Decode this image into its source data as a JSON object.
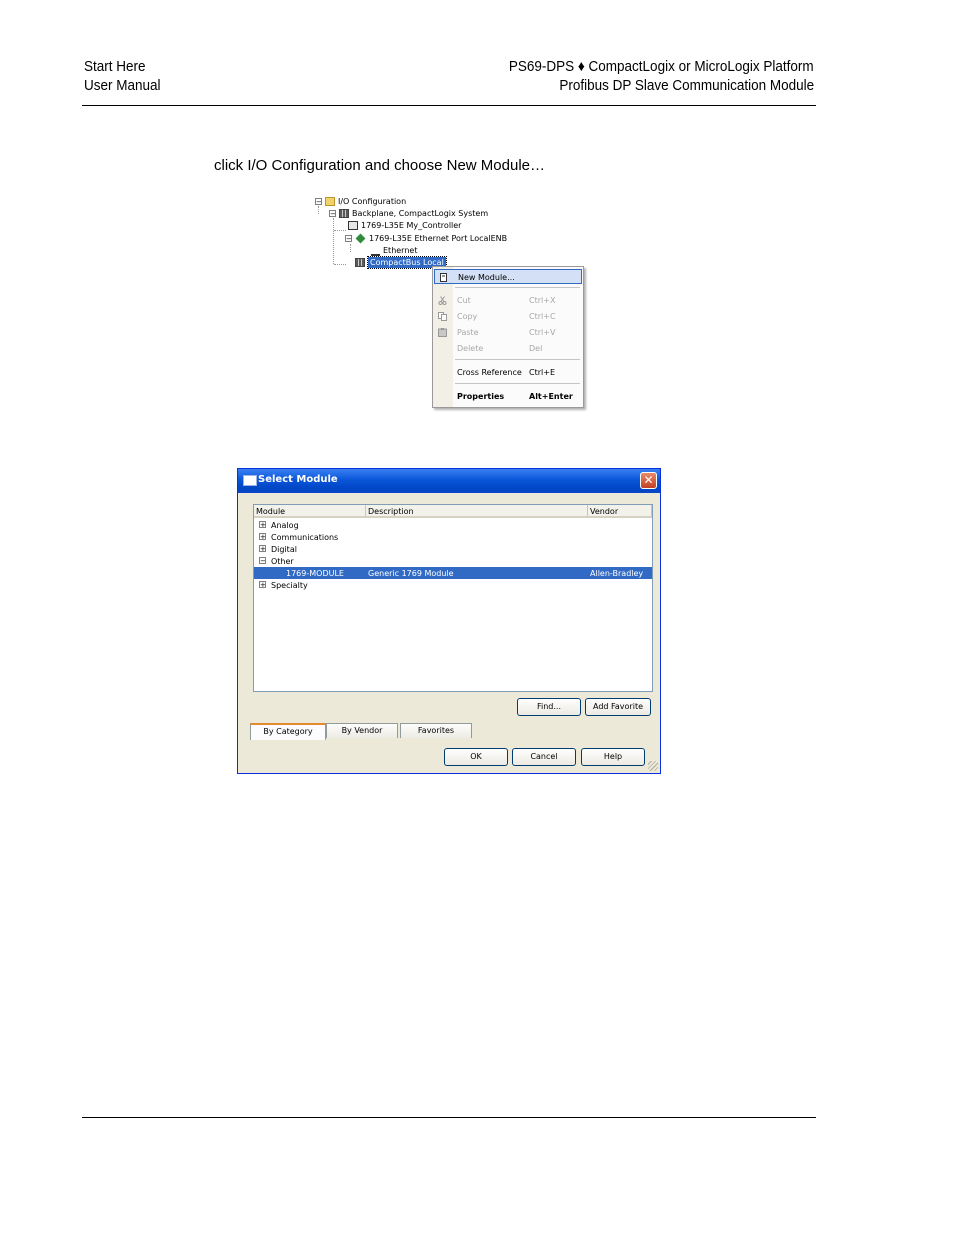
{
  "header": {
    "left_line1": "Start Here",
    "left_line2": "User Manual",
    "right_line1": "PS69-DPS ♦ CompactLogix or MicroLogix Platform",
    "right_line2": "Profibus DP Slave Communication Module"
  },
  "instruction": "click I/O Configuration and choose New Module…",
  "tree": {
    "io_configuration": "I/O Configuration",
    "backplane": "Backplane, CompactLogix System",
    "controller": "1769-L35E My_Controller",
    "ethernet_port": "1769-L35E Ethernet Port LocalENB",
    "ethernet": "Ethernet",
    "compactbus": "CompactBus Local"
  },
  "context_menu": {
    "items": [
      {
        "label": "New Module...",
        "shortcut": ""
      },
      {
        "label": "Cut",
        "shortcut": "Ctrl+X"
      },
      {
        "label": "Copy",
        "shortcut": "Ctrl+C"
      },
      {
        "label": "Paste",
        "shortcut": "Ctrl+V"
      },
      {
        "label": "Delete",
        "shortcut": "Del"
      },
      {
        "label": "Cross Reference",
        "shortcut": "Ctrl+E"
      },
      {
        "label": "Properties",
        "shortcut": "Alt+Enter"
      }
    ]
  },
  "dialog": {
    "title": "Select Module",
    "close_glyph": "✕",
    "columns": [
      "Module",
      "Description",
      "Vendor"
    ],
    "rows": [
      {
        "expander": "+",
        "module": "Analog",
        "description": "",
        "vendor": ""
      },
      {
        "expander": "+",
        "module": "Communications",
        "description": "",
        "vendor": ""
      },
      {
        "expander": "+",
        "module": "Digital",
        "description": "",
        "vendor": ""
      },
      {
        "expander": "−",
        "module": "Other",
        "description": "",
        "vendor": ""
      },
      {
        "expander": "",
        "module": "1769-MODULE",
        "description": "Generic 1769 Module",
        "vendor": "Allen-Bradley"
      },
      {
        "expander": "+",
        "module": "Specialty",
        "description": "",
        "vendor": ""
      }
    ],
    "buttons": {
      "find": "Find...",
      "add_favorite": "Add Favorite",
      "ok": "OK",
      "cancel": "Cancel",
      "help": "Help"
    },
    "tabs": [
      "By Category",
      "By Vendor",
      "Favorites"
    ]
  }
}
